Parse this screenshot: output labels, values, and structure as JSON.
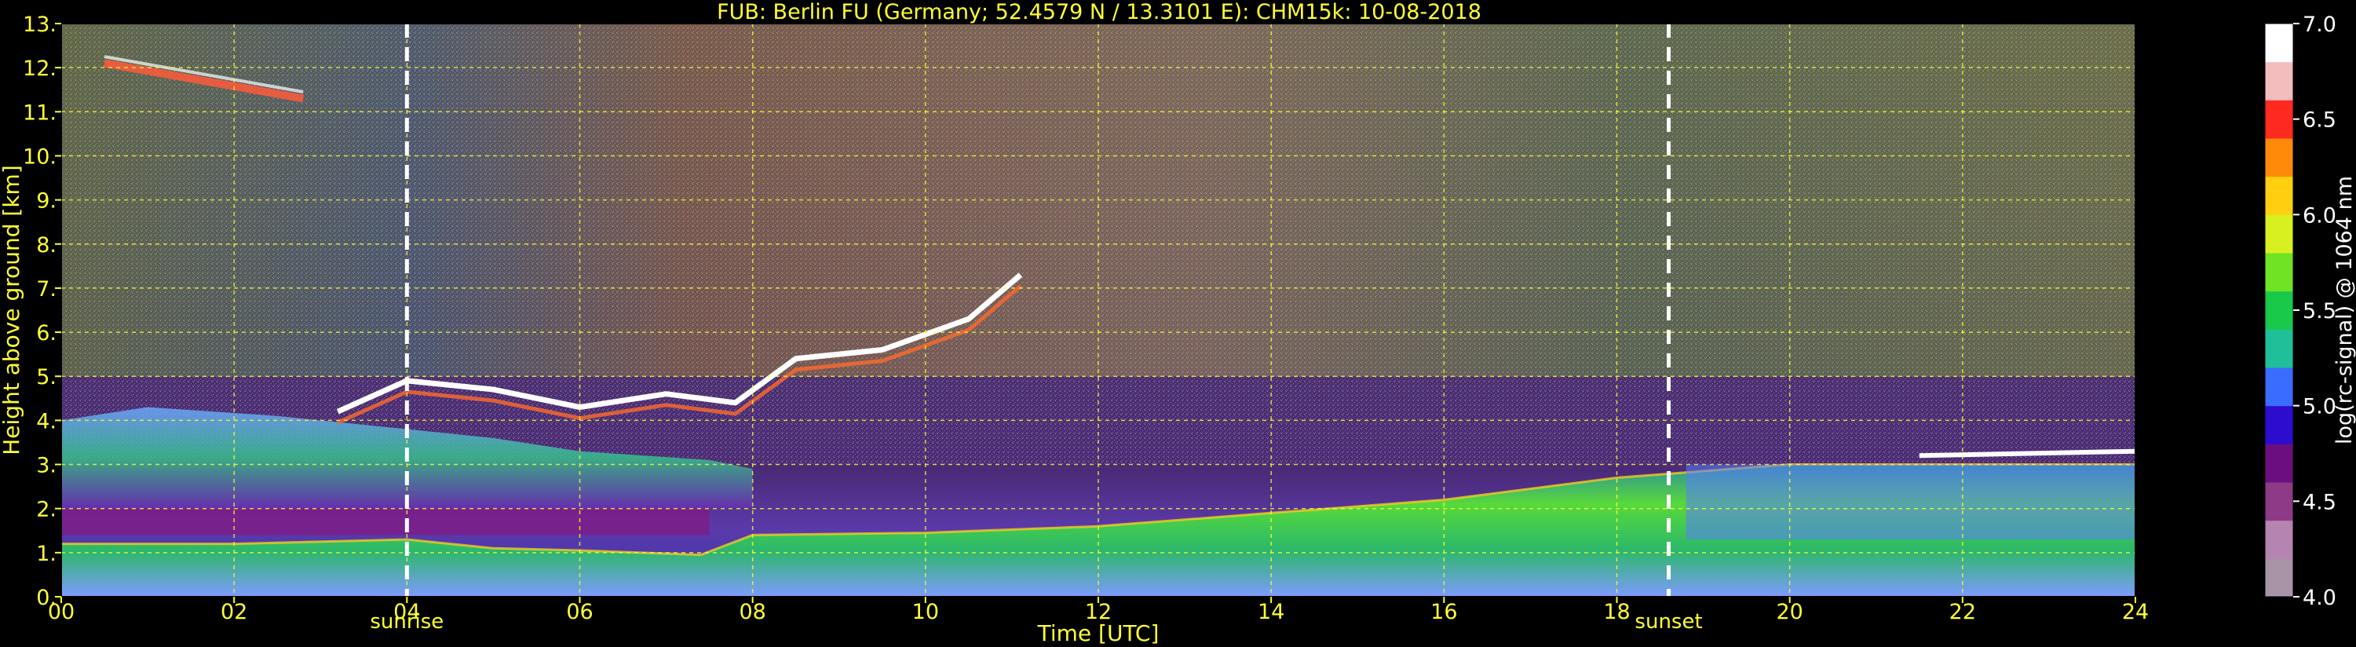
{
  "chart_data": {
    "type": "heatmap",
    "title": "FUB: Berlin FU (Germany; 52.4579 N / 13.3101 E):    CHM15k: 10-08-2018",
    "xlabel": "Time [UTC]",
    "ylabel": "Height above ground [km]",
    "xlim": [
      0,
      24
    ],
    "ylim": [
      0,
      13
    ],
    "x_ticks": [
      "00",
      "02",
      "04",
      "06",
      "08",
      "10",
      "12",
      "14",
      "16",
      "18",
      "20",
      "22",
      "24"
    ],
    "y_ticks": [
      "0.",
      "1.",
      "2.",
      "3.",
      "4.",
      "5.",
      "6.",
      "7.",
      "8.",
      "9.",
      "10.",
      "11.",
      "12.",
      "13."
    ],
    "grid": true,
    "events": [
      {
        "label": "sunrise",
        "x": 4.0
      },
      {
        "label": "sunset",
        "x": 18.6
      }
    ],
    "colorbar": {
      "label": "log(rc-signal) @ 1064 nm",
      "range": [
        4.0,
        7.0
      ],
      "ticks": [
        "4.0",
        "4.5",
        "5.0",
        "5.5",
        "6.0",
        "6.5",
        "7.0"
      ]
    },
    "layers": {
      "boundary_layer_top_km": [
        [
          0,
          1.2
        ],
        [
          2,
          1.2
        ],
        [
          4,
          1.3
        ],
        [
          5,
          1.1
        ],
        [
          6,
          1.05
        ],
        [
          7.4,
          0.95
        ],
        [
          8,
          1.4
        ],
        [
          10,
          1.45
        ],
        [
          12,
          1.6
        ],
        [
          14,
          1.9
        ],
        [
          16,
          2.2
        ],
        [
          18,
          2.7
        ],
        [
          20,
          3.0
        ],
        [
          22,
          3.0
        ],
        [
          24,
          3.0
        ]
      ],
      "cloud_base_km": [
        [
          3.2,
          4.2
        ],
        [
          4.0,
          4.9
        ],
        [
          5.0,
          4.7
        ],
        [
          6.0,
          4.3
        ],
        [
          7.0,
          4.6
        ],
        [
          7.8,
          4.4
        ],
        [
          8.5,
          5.4
        ],
        [
          9.5,
          5.6
        ],
        [
          10.5,
          6.3
        ],
        [
          11.1,
          7.3
        ]
      ],
      "high_cloud_km": [
        [
          0.5,
          12.1
        ],
        [
          2.8,
          11.3
        ]
      ],
      "evening_cloud_km": [
        [
          21.5,
          3.2
        ],
        [
          24,
          3.3
        ]
      ]
    }
  },
  "colors": {
    "title": "#ffff33",
    "grid": "#ffff33",
    "event_line": "#ffffff",
    "colorbar": [
      "#a893a7",
      "#b684b0",
      "#8e3a87",
      "#6b0f80",
      "#2d0bcf",
      "#3a6cff",
      "#1fbf9a",
      "#19c94a",
      "#70e324",
      "#d8f020",
      "#ffcf10",
      "#ff8a0a",
      "#ff2a1f",
      "#f4bdbd",
      "#ffffff"
    ]
  }
}
